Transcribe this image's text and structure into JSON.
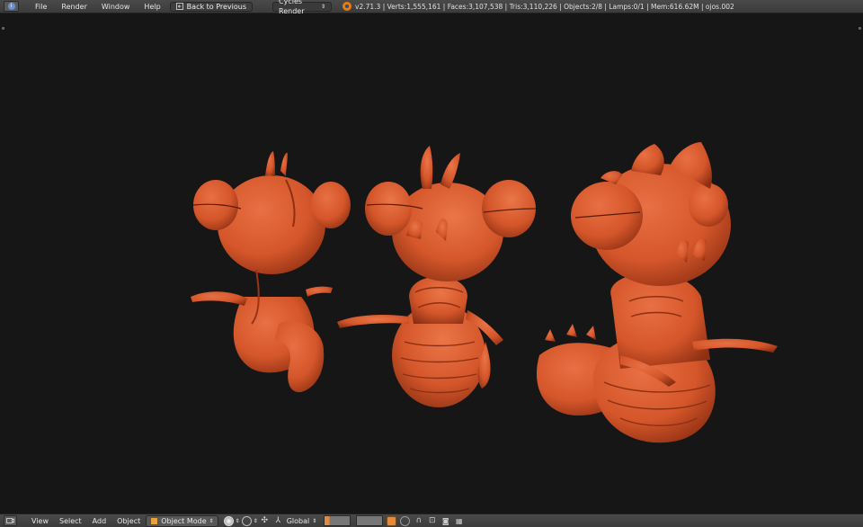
{
  "topbar": {
    "menus": [
      "File",
      "Render",
      "Window",
      "Help"
    ],
    "back_button": "Back to Previous",
    "render_engine": "Cycles Render",
    "stats": "v2.71.3 | Verts:1,555,161 | Faces:3,107,538 | Tris:3,110,226 | Objects:2/8 | Lamps:0/1 | Mem:616.62M | ojos.002"
  },
  "bottombar": {
    "menus": [
      "View",
      "Select",
      "Add",
      "Object"
    ],
    "mode": "Object Mode",
    "orientation": "Global"
  },
  "viewport": {
    "background": "#161616",
    "model_color": "#d4562a",
    "model_shadow": "#8e2f13",
    "model_highlight": "#e87044"
  },
  "icons": {
    "editor_type": "info-icon",
    "back": "back-arrow-icon",
    "blender_logo": "blender-logo-icon",
    "view3d": "view3d-icon",
    "mode": "cube-icon",
    "shading": "sphere-shading-icon",
    "pivot": "pivot-icon",
    "manipulator": "manipulator-icon",
    "orientation": "axis-icon",
    "layers": "layer-icon",
    "lock": "lock-icon",
    "snap": "magnet-icon",
    "render": "camera-icon",
    "animation": "clapper-icon"
  }
}
